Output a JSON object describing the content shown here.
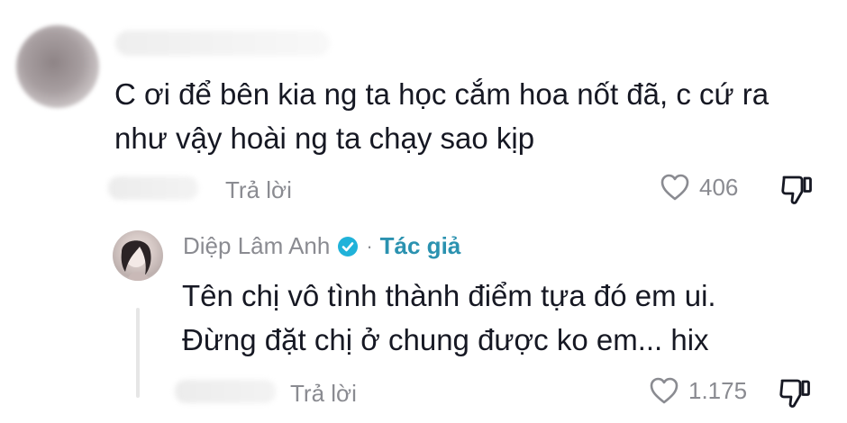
{
  "comment": {
    "text_line1": "C ơi để bên kia ng ta học cắm hoa nốt đã, c cứ ra",
    "text_line2": "như vậy hoài ng ta chạy sao kịp",
    "reply_label": "Trả lời",
    "like_count": "406",
    "icons": {
      "like": "heart-outline-icon",
      "dislike": "thumbs-down-icon"
    }
  },
  "reply": {
    "author_name": "Diệp Lâm Anh",
    "author_tag": "Tác giả",
    "separator": "·",
    "text_line1": "Tên chị vô tình thành điểm tựa đó em ui.",
    "text_line2": "Đừng đặt chị ở chung được ko em... hix",
    "reply_label": "Trả lời",
    "like_count": "1.175",
    "icons": {
      "verified": "verified-check-icon",
      "like": "heart-outline-icon",
      "dislike": "thumbs-down-icon"
    }
  },
  "colors": {
    "text": "#161823",
    "muted": "#8a8b91",
    "verified": "#20b2d9",
    "author_tag": "#2b92b0"
  }
}
